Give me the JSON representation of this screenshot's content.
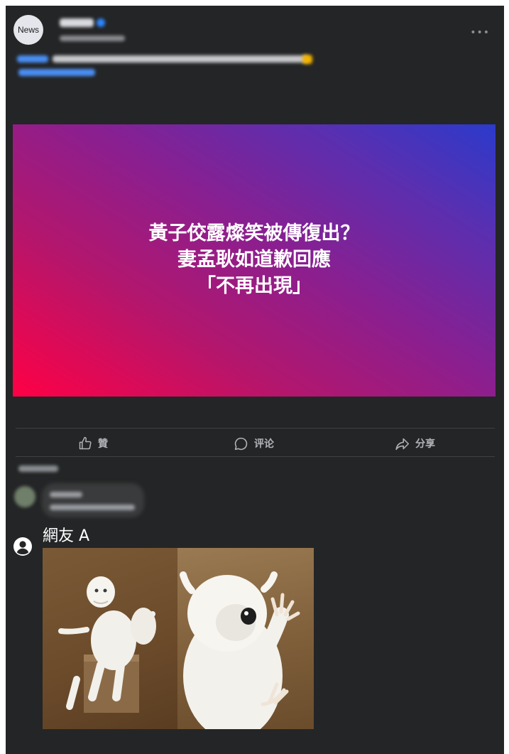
{
  "post": {
    "avatar_label": "News",
    "banner_lines": [
      "黃子佼露燦笑被傳復出？",
      "妻孟耿如道歉回應",
      "「不再出現」"
    ]
  },
  "actions": {
    "like": "贊",
    "comment": "评论",
    "share": "分享"
  },
  "reply": {
    "user_name": "網友 A"
  },
  "colors": {
    "card_bg": "#242526",
    "text_secondary": "#b0b3b8",
    "banner_start": "#ff0045",
    "banner_end": "#2b3acb"
  }
}
